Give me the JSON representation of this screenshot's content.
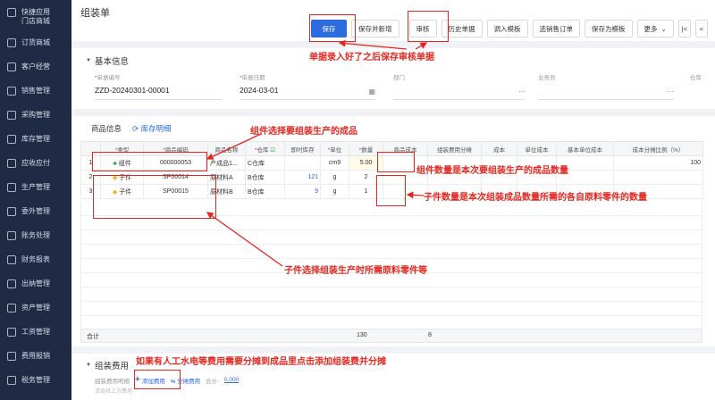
{
  "sidebar": {
    "items": [
      {
        "label": "快捷应用\n门店商城"
      },
      {
        "label": "订货商城"
      },
      {
        "label": "客户经营"
      },
      {
        "label": "销售管理"
      },
      {
        "label": "采购管理"
      },
      {
        "label": "库存管理"
      },
      {
        "label": "应收应付"
      },
      {
        "label": "生产管理"
      },
      {
        "label": "委外管理"
      },
      {
        "label": "账务处理"
      },
      {
        "label": "财务报表"
      },
      {
        "label": "出纳管理"
      },
      {
        "label": "资产管理"
      },
      {
        "label": "工资管理"
      },
      {
        "label": "费用报销"
      },
      {
        "label": "税务管理"
      }
    ]
  },
  "page": {
    "title": "组装单"
  },
  "toolbar": {
    "save": "保存",
    "save_new": "保存并新增",
    "audit": "审核",
    "history": "历史单据",
    "import_template": "调入模板",
    "select_sales_order": "选销售订单",
    "save_as_template": "保存为模板",
    "more": "更多",
    "first": "|<",
    "prev": "<"
  },
  "basic_info": {
    "section_title": "基本信息",
    "doc_no_label": "单据编号",
    "doc_no": "ZZD-20240301-00001",
    "date_label": "单据日期",
    "date": "2024-03-01",
    "dept_label": "部门",
    "staff_label": "业务员",
    "warehouse_label": "仓库"
  },
  "goods": {
    "tab_info": "商品信息",
    "tab_detail": "库存明细",
    "columns": [
      "",
      "类型",
      "商品编码",
      "商品名称",
      "仓库",
      "即时库存",
      "单位",
      "数量",
      "商品成本",
      "组装费用分摊",
      "成本",
      "单位成本",
      "基本单位成本",
      "成本分摊比例（%）"
    ],
    "rows": [
      {
        "no": "1",
        "type": "组件",
        "code": "000000053",
        "name": "产成品1...",
        "wh": "C仓库",
        "stock": "",
        "unit": "cm9",
        "qty": "5.00",
        "ratio": "100"
      },
      {
        "no": "2",
        "type": "子件",
        "code": "SP00014",
        "name": "原材料A",
        "wh": "B仓库",
        "stock": "121",
        "unit": "g",
        "qty": "2",
        "ratio": ""
      },
      {
        "no": "3",
        "type": "子件",
        "code": "SP00015",
        "name": "原材料B",
        "wh": "B仓库",
        "stock": "9",
        "unit": "g",
        "qty": "1",
        "ratio": ""
      }
    ],
    "total_label": "合计",
    "total_stock": "130",
    "total_qty": "8"
  },
  "fee": {
    "section_title": "组装费用",
    "detail_label": "组装费用明细",
    "add_fee": "添加费用",
    "split_fee": "分摊费用",
    "total_label": "合计:",
    "total_value": "0.000",
    "sub_hint": "请选择上方费用"
  },
  "annotations": {
    "save_audit": "单据录入好了之后保存审核单据",
    "assembly": "组件选择要组装生产的成品",
    "assembly_qty": "组件数量是本次要组装生产的成品数量",
    "part_qty": "子件数量是本次组装成品数量所需的各自原料零件的数量",
    "parts": "子件选择组装生产时所需原料零件等",
    "fee": "如果有人工水电等费用需要分摊到成品里点击添加组装费并分摊"
  }
}
